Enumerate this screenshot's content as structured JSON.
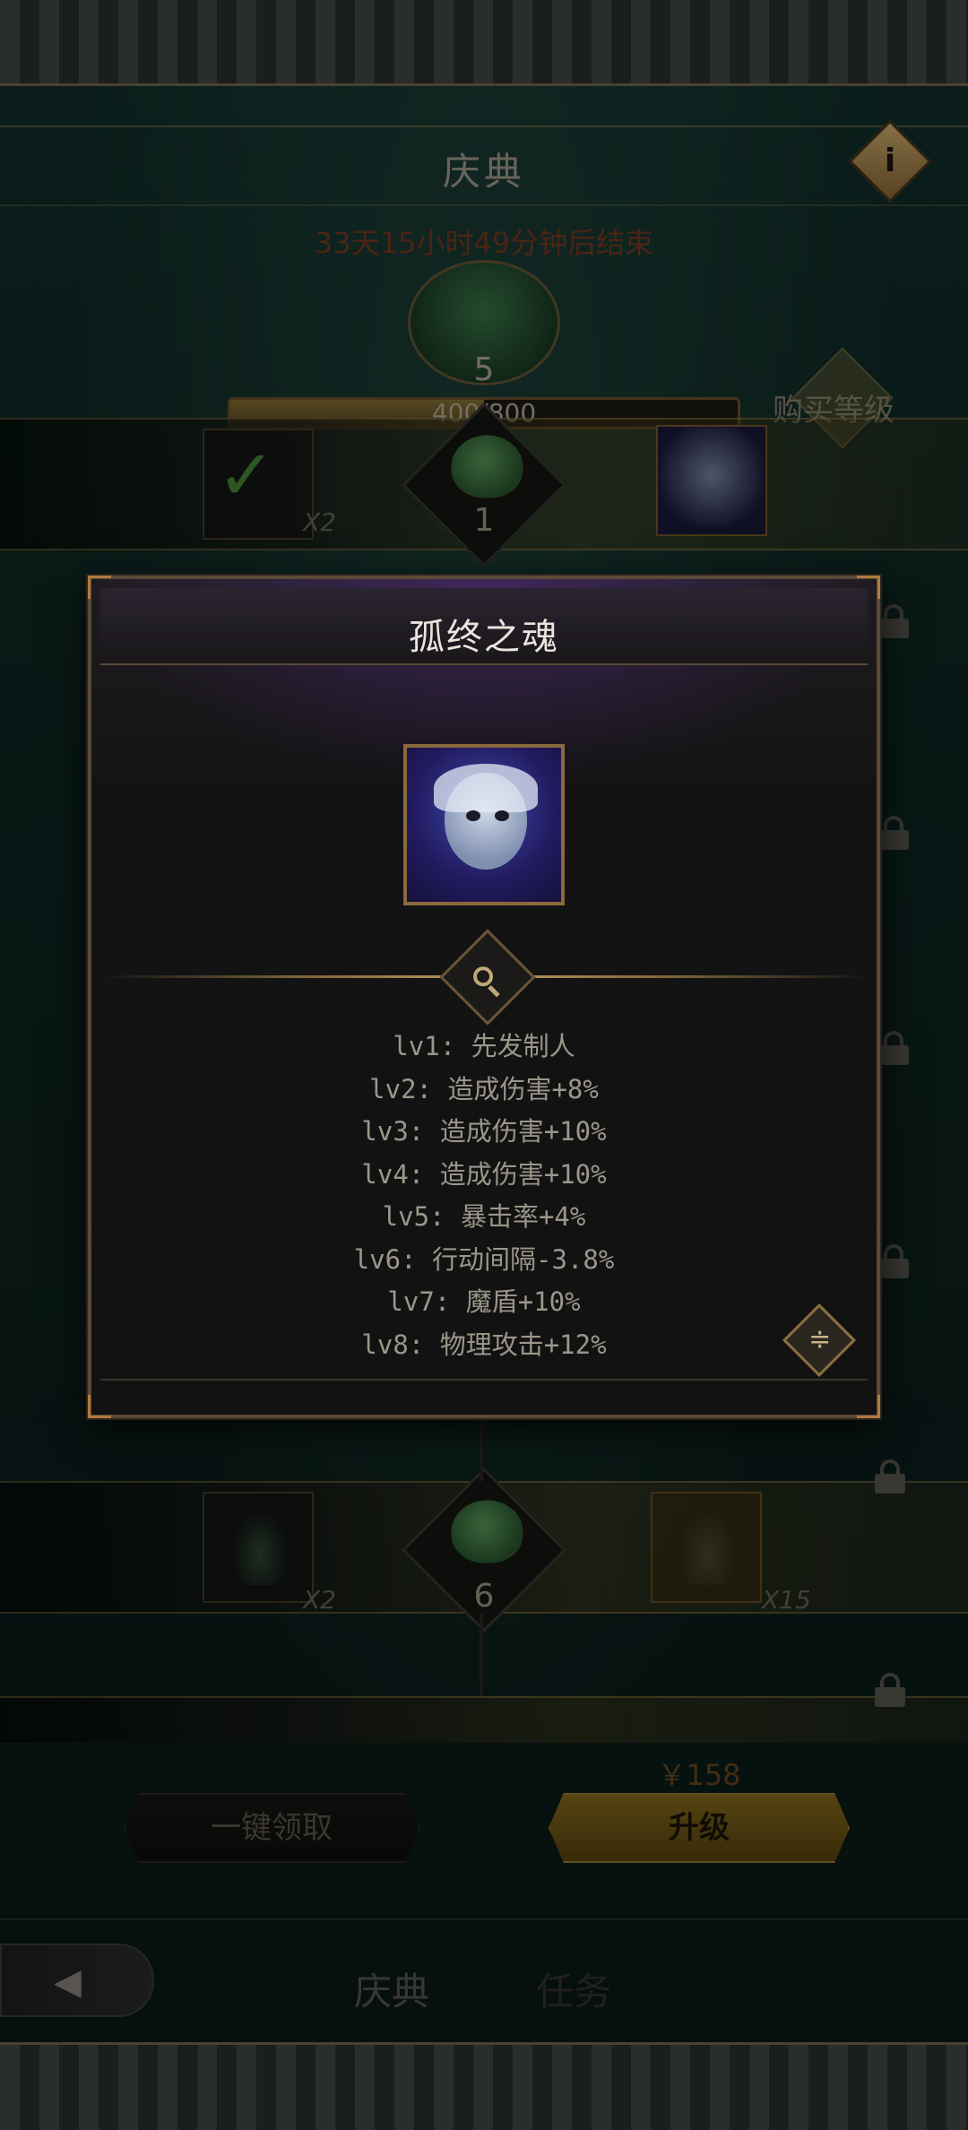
{
  "header": {
    "title": "庆典",
    "info_icon": "info-icon",
    "info_label": "i"
  },
  "countdown": "33天15小时49分钟后结束",
  "level": {
    "current": "5",
    "xp_text": "400/800",
    "xp_fraction": 0.5,
    "buy_label": "购买等级"
  },
  "rows": [
    {
      "tier": "1",
      "free_qty": "X2",
      "free_claimed": true,
      "premium_item": "ghost-portrait"
    },
    {
      "tier": "6",
      "free_qty": "X2",
      "premium_qty": "X15"
    }
  ],
  "modal": {
    "title": "孤终之魂",
    "skills": [
      "lv1: 先发制人",
      "lv2: 造成伤害+8%",
      "lv3: 造成伤害+10%",
      "lv4: 造成伤害+10%",
      "lv5: 暴击率+4%",
      "lv6: 行动间隔-3.8%",
      "lv7: 魔盾+10%",
      "lv8: 物理攻击+12%"
    ],
    "collapse_glyph": "≑"
  },
  "actions": {
    "price": "￥158",
    "claim_all": "一键领取",
    "upgrade": "升级"
  },
  "tabs": {
    "celebration": "庆典",
    "tasks": "任务"
  },
  "colors": {
    "accent_gold": "#c09a5a",
    "rare_purple": "#7a3cc8",
    "claimed_green": "#4c8a3a"
  }
}
